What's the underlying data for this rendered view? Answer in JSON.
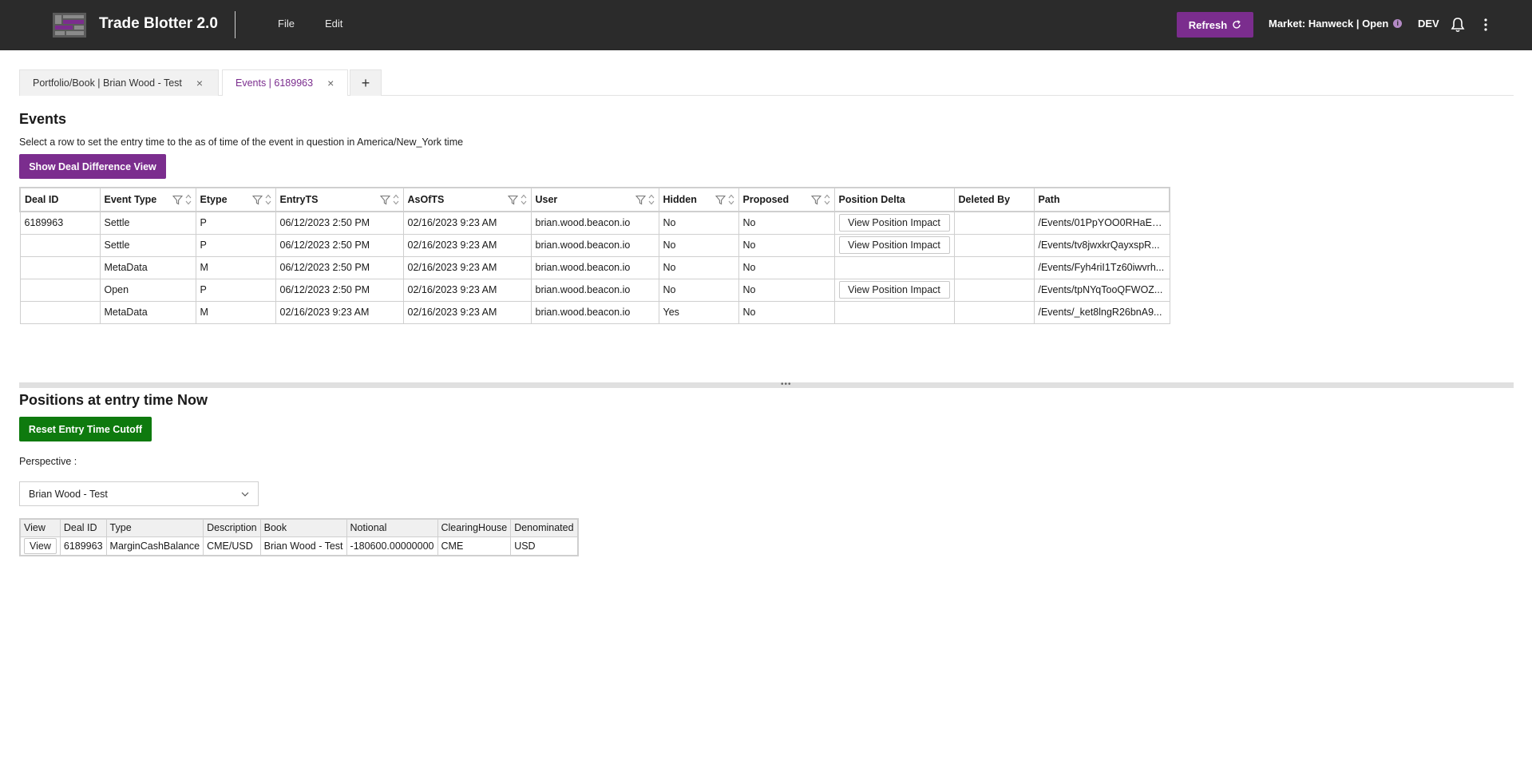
{
  "app": {
    "title": "Trade Blotter 2.0",
    "menu": [
      "File",
      "Edit"
    ],
    "refresh_label": "Refresh",
    "market_label": "Market: Hanweck | Open",
    "env": "DEV",
    "accent": "#7b2d8e",
    "topbar_bg": "#2b2b2b"
  },
  "tabs": [
    {
      "label": "Portfolio/Book | Brian Wood - Test",
      "active": false
    },
    {
      "label": "Events | 6189963",
      "active": true
    }
  ],
  "tab_add": "+",
  "events": {
    "title": "Events",
    "hint": "Select a row to set the entry time to the as of time of the event in question in America/New_York time",
    "deal_diff_label": "Show Deal Difference View",
    "columns": [
      "Deal ID",
      "Event Type",
      "Etype",
      "EntryTS",
      "AsOfTS",
      "User",
      "Hidden",
      "Proposed",
      "Position Delta",
      "Deleted By",
      "Path"
    ],
    "view_impact_label": "View Position Impact",
    "rows": [
      {
        "deal_id": "6189963",
        "event_type": "Settle",
        "etype": "P",
        "entry_ts": "06/12/2023 2:50 PM",
        "asof_ts": "02/16/2023 9:23 AM",
        "user": "brian.wood.beacon.io",
        "hidden": "No",
        "proposed": "No",
        "impact": true,
        "deleted_by": "",
        "path": "/Events/01PpYOO0RHaE8..."
      },
      {
        "deal_id": "",
        "event_type": "Settle",
        "etype": "P",
        "entry_ts": "06/12/2023 2:50 PM",
        "asof_ts": "02/16/2023 9:23 AM",
        "user": "brian.wood.beacon.io",
        "hidden": "No",
        "proposed": "No",
        "impact": true,
        "deleted_by": "",
        "path": "/Events/tv8jwxkrQayxspR..."
      },
      {
        "deal_id": "",
        "event_type": "MetaData",
        "etype": "M",
        "entry_ts": "06/12/2023 2:50 PM",
        "asof_ts": "02/16/2023 9:23 AM",
        "user": "brian.wood.beacon.io",
        "hidden": "No",
        "proposed": "No",
        "impact": false,
        "deleted_by": "",
        "path": "/Events/Fyh4riI1Tz60iwvrh..."
      },
      {
        "deal_id": "",
        "event_type": "Open",
        "etype": "P",
        "entry_ts": "06/12/2023 2:50 PM",
        "asof_ts": "02/16/2023 9:23 AM",
        "user": "brian.wood.beacon.io",
        "hidden": "No",
        "proposed": "No",
        "impact": true,
        "deleted_by": "",
        "path": "/Events/tpNYqTooQFWOZ..."
      },
      {
        "deal_id": "",
        "event_type": "MetaData",
        "etype": "M",
        "entry_ts": "02/16/2023 9:23 AM",
        "asof_ts": "02/16/2023 9:23 AM",
        "user": "brian.wood.beacon.io",
        "hidden": "Yes",
        "proposed": "No",
        "impact": false,
        "deleted_by": "",
        "path": "/Events/_ket8lngR26bnA9..."
      }
    ]
  },
  "positions": {
    "title": "Positions at entry time Now",
    "reset_label": "Reset Entry Time Cutoff",
    "perspective_label": "Perspective :",
    "perspective_value": "Brian Wood - Test",
    "columns": [
      "View",
      "Deal ID",
      "Type",
      "Description",
      "Book",
      "Notional",
      "ClearingHouse",
      "Denominated"
    ],
    "view_label": "View",
    "rows": [
      {
        "deal_id": "6189963",
        "type": "MarginCashBalance",
        "description": "CME/USD",
        "book": "Brian Wood - Test",
        "notional": "-180600.00000000",
        "clearing_house": "CME",
        "denominated": "USD"
      }
    ],
    "reset_color": "#0e7a0e"
  }
}
